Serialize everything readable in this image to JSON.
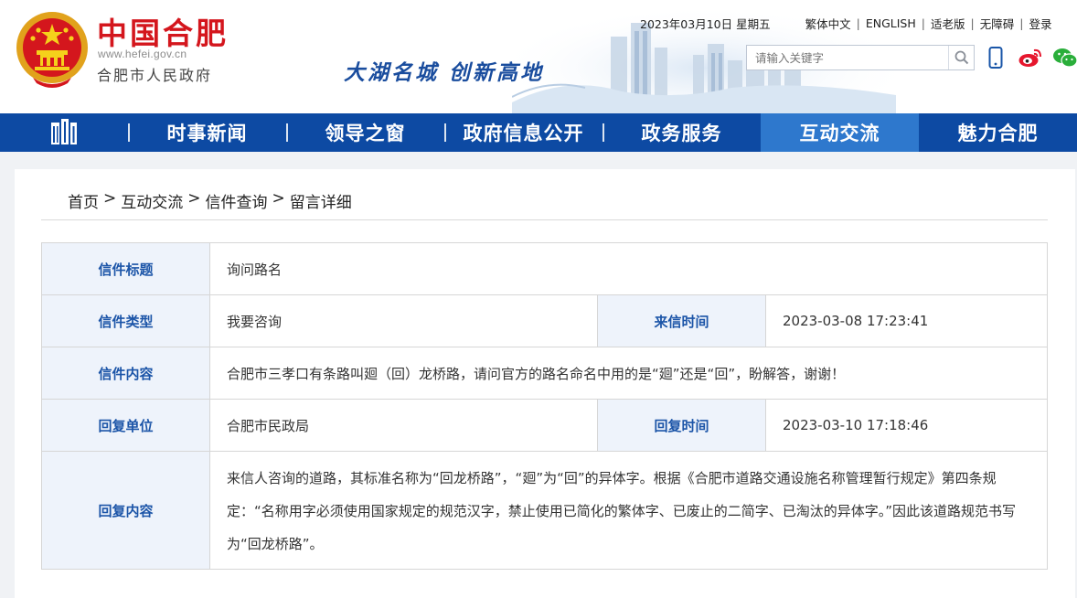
{
  "header": {
    "logo_cn": "中国合肥",
    "logo_url": "www.hefei.gov.cn",
    "logo_gov": "合肥市人民政府",
    "slogan": "大湖名城  创新高地",
    "date": "2023年03月10日 星期五",
    "links": [
      "繁体中文",
      "ENGLISH",
      "适老版",
      "无障碍",
      "登录"
    ],
    "search_placeholder": "请输入关键字",
    "icons": [
      "search-icon",
      "mobile-icon",
      "weibo-icon",
      "wechat-icon"
    ]
  },
  "nav": {
    "home_icon": "building-icon",
    "items": [
      "时事新闻",
      "领导之窗",
      "政府信息公开",
      "政务服务",
      "互动交流",
      "魅力合肥"
    ],
    "active_index": 4
  },
  "breadcrumb": [
    "首页",
    "互动交流",
    "信件查询",
    "留言详细"
  ],
  "breadcrumb_sep": ">",
  "letter": {
    "title_label": "信件标题",
    "title": "询问路名",
    "type_label": "信件类型",
    "type": "我要咨询",
    "received_label": "来信时间",
    "received_time": "2023-03-08 17:23:41",
    "content_label": "信件内容",
    "content": "合肥市三孝口有条路叫廻（回）龙桥路，请问官方的路名命名中用的是“廻”还是“回”，盼解答，谢谢！",
    "reply_unit_label": "回复单位",
    "reply_unit": "合肥市民政局",
    "reply_time_label": "回复时间",
    "reply_time": "2023-03-10 17:18:46",
    "reply_content_label": "回复内容",
    "reply_content": "来信人咨询的道路，其标准名称为“回龙桥路”，“廻”为“回”的异体字。根据《合肥市道路交通设施名称管理暂行规定》第四条规定：“名称用字必须使用国家规定的规范汉字，禁止使用已简化的繁体字、已废止的二简字、已淘汰的异体字。”因此该道路规范书写为“回龙桥路”。"
  },
  "colors": {
    "brand_red": "#d4161d",
    "nav_blue": "#0d4aa3",
    "nav_active": "#2e78cd",
    "label_blue": "#1c55a8",
    "label_bg": "#eef3fb"
  }
}
